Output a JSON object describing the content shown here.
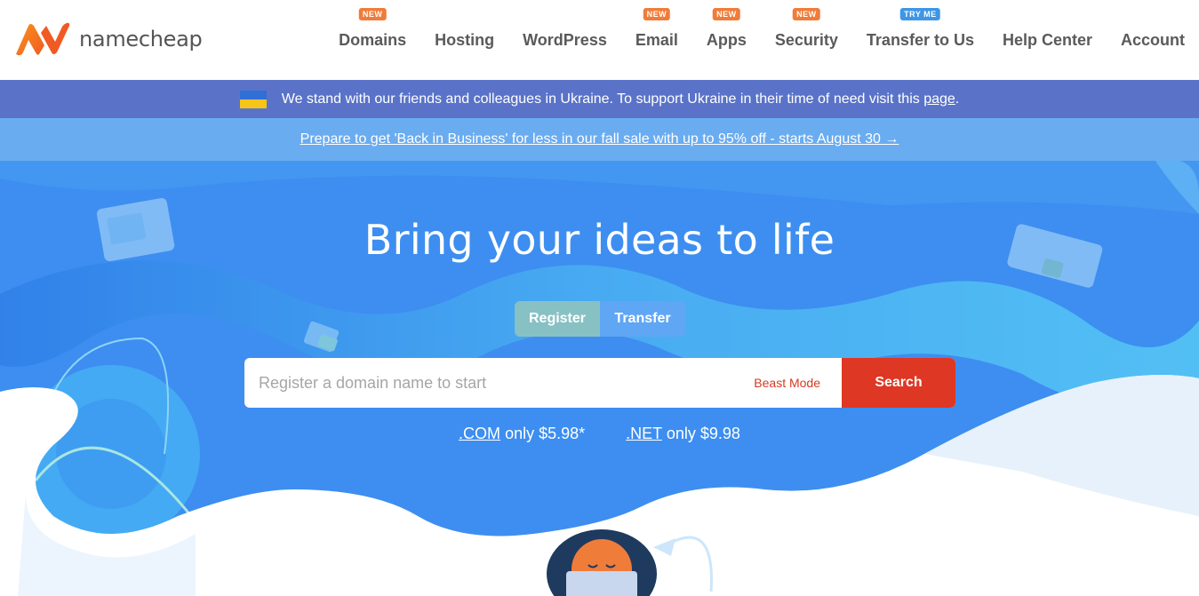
{
  "brand": {
    "name": "namecheap",
    "colors": {
      "orange": "#f15a22",
      "orange_light": "#f7941d",
      "nav_badge": "#f07c3a",
      "badge_blue": "#3e96e6",
      "search_red": "#de3723"
    }
  },
  "nav": {
    "items": [
      {
        "label": "Domains",
        "badge": "NEW"
      },
      {
        "label": "Hosting",
        "badge": ""
      },
      {
        "label": "WordPress",
        "badge": ""
      },
      {
        "label": "Email",
        "badge": "NEW"
      },
      {
        "label": "Apps",
        "badge": "NEW"
      },
      {
        "label": "Security",
        "badge": "NEW"
      },
      {
        "label": "Transfer to Us",
        "badge": "TRY ME"
      },
      {
        "label": "Help Center",
        "badge": ""
      },
      {
        "label": "Account",
        "badge": ""
      }
    ]
  },
  "ukraine_banner": {
    "text": "We stand with our friends and colleagues in Ukraine. To support Ukraine in their time of need visit this",
    "link": "page",
    "end": "."
  },
  "promo": {
    "link": "Prepare to get 'Back in Business' for less in our fall sale with up to 95% off - starts August 30 →"
  },
  "hero": {
    "title": "Bring your ideas to life",
    "tabs": {
      "register": "Register",
      "transfer": "Transfer"
    },
    "search": {
      "placeholder": "Register a domain name to start",
      "beast_mode": "Beast Mode",
      "button": "Search"
    },
    "prices": [
      {
        "tld": ".COM",
        "text": "only $5.98*"
      },
      {
        "tld": ".NET",
        "text": "only $9.98"
      }
    ]
  }
}
